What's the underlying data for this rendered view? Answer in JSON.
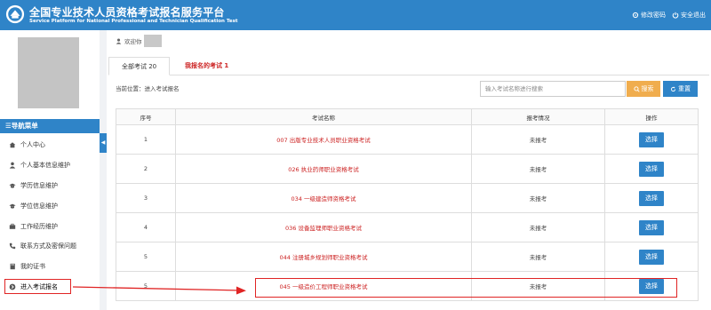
{
  "header": {
    "title_cn": "全国专业技术人员资格考试报名服务平台",
    "title_en": "Service Platform for National Professional and Technician Qualification Test",
    "change_password": "修改密码",
    "logout": "安全退出"
  },
  "sidebar": {
    "nav_header": "☰导航菜单",
    "toggle": "◀",
    "items": [
      {
        "label": "个人中心",
        "icon": "home-icon"
      },
      {
        "label": "个人基本信息维护",
        "icon": "user-icon"
      },
      {
        "label": "学历信息维护",
        "icon": "graduation-cap-icon"
      },
      {
        "label": "学位信息维护",
        "icon": "graduation-cap-icon"
      },
      {
        "label": "工作经历维护",
        "icon": "briefcase-icon"
      },
      {
        "label": "联系方式及密保问题",
        "icon": "phone-icon"
      },
      {
        "label": "我的证书",
        "icon": "book-icon"
      },
      {
        "label": "进入考试报名",
        "icon": "arrow-circle-icon"
      }
    ]
  },
  "main": {
    "welcome": "欢迎你",
    "tabs": [
      {
        "label": "全部考试 20"
      },
      {
        "label": "我报名的考试 1"
      }
    ],
    "breadcrumb": "当前位置：进入考试报名",
    "search_placeholder": "输入考试名称进行搜索",
    "search_label": "搜索",
    "reset_label": "重置",
    "table": {
      "headers": [
        "序号",
        "考试名称",
        "报考情况",
        "操作"
      ],
      "rows": [
        {
          "no": "1",
          "name": "007 出版专业技术人员职业资格考试",
          "status": "未报考",
          "action": "选择"
        },
        {
          "no": "2",
          "name": "026 执业药师职业资格考试",
          "status": "未报考",
          "action": "选择"
        },
        {
          "no": "3",
          "name": "034 一级建造师资格考试",
          "status": "未报考",
          "action": "选择"
        },
        {
          "no": "4",
          "name": "036 设备监理师职业资格考试",
          "status": "未报考",
          "action": "选择"
        },
        {
          "no": "5",
          "name": "044 注册城乡规划师职业资格考试",
          "status": "未报考",
          "action": "选择"
        },
        {
          "no": "5",
          "name": "045 一级造价工程师职业资格考试",
          "status": "未报考",
          "action": "选择"
        }
      ]
    }
  },
  "colors": {
    "primary": "#2f84c8",
    "accent_orange": "#f0ad4e",
    "highlight_red": "#e02424",
    "exam_name_red": "#cc2222"
  }
}
